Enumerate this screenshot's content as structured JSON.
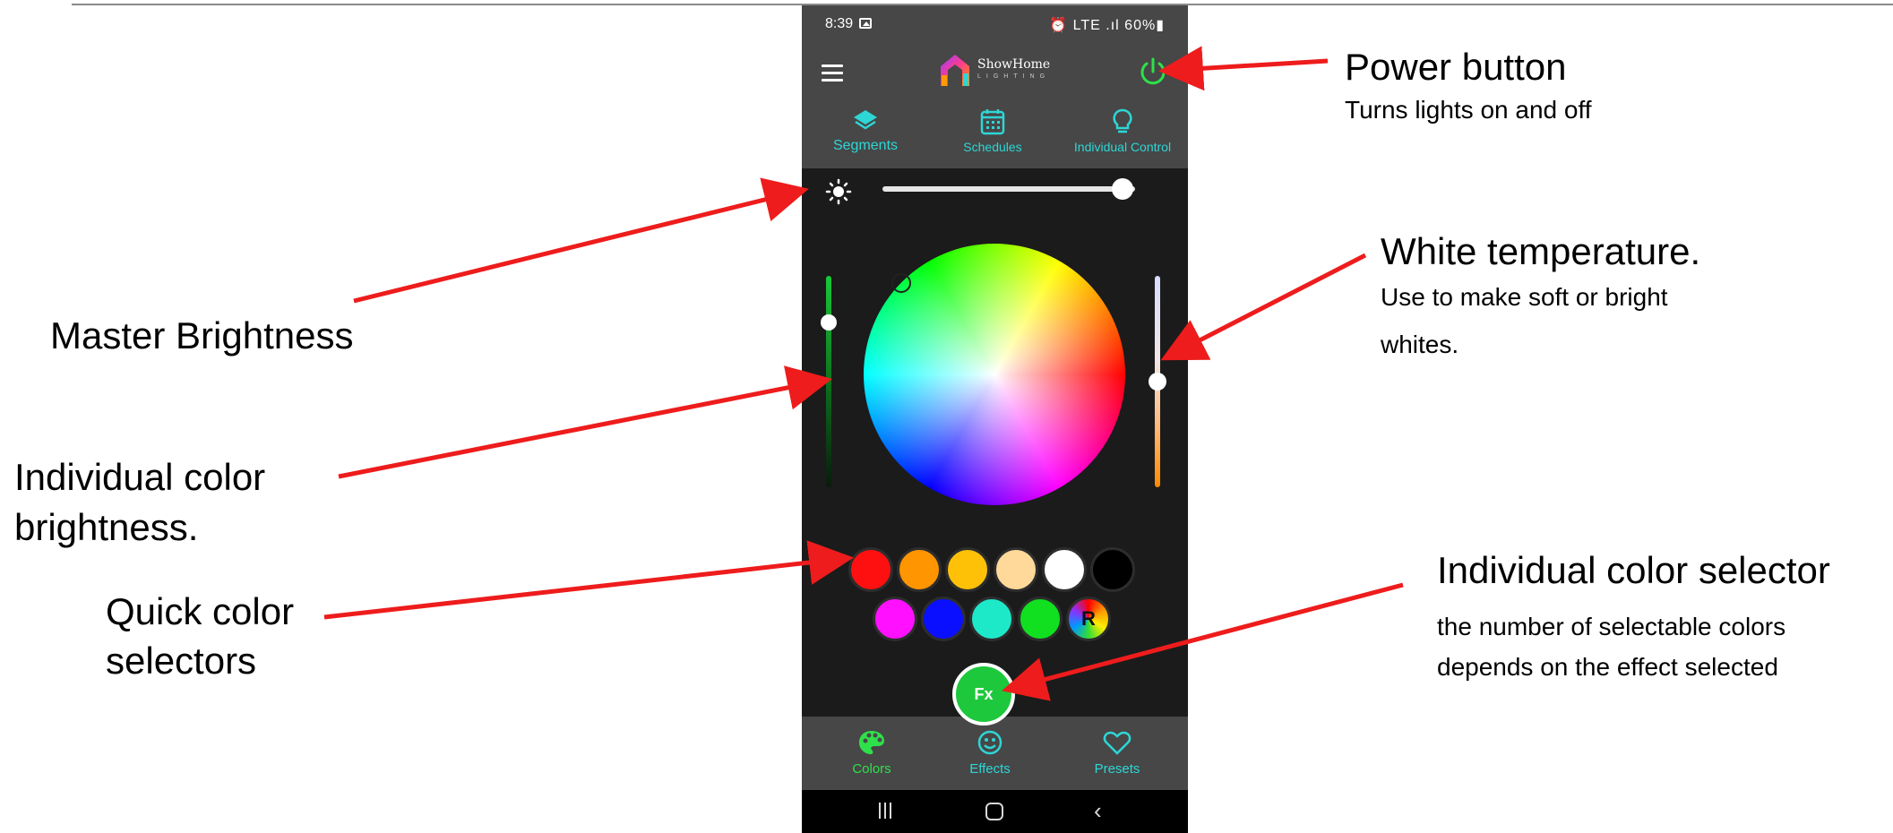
{
  "phone": {
    "status_bar": {
      "time": "8:39",
      "right_status": "⏰ LTE .ıl 60%▮"
    },
    "header": {
      "brand_name": "ShowHome",
      "brand_sub": "LIGHTING"
    },
    "nav_tabs": [
      {
        "label": "Segments",
        "icon": "layers-icon"
      },
      {
        "label": "Schedules",
        "icon": "calendar-icon"
      },
      {
        "label": "Individual Control",
        "icon": "bulb-icon"
      }
    ],
    "master_brightness": 0.95,
    "color_brightness": 0.78,
    "white_temperature": 0.5,
    "quick_colors_row1": [
      "#ff1010",
      "#ff9500",
      "#ffc107",
      "#ffd99a",
      "#ffffff",
      "#000000"
    ],
    "quick_colors_row2": [
      "#ff10ff",
      "#0a10ff",
      "#1de9c9",
      "#10e020",
      "rainbow"
    ],
    "rainbow_label": "R",
    "fx_label": "Fx",
    "bottom_tabs": [
      {
        "label": "Colors",
        "icon": "palette-icon",
        "active": true
      },
      {
        "label": "Effects",
        "icon": "smiley-icon",
        "active": false
      },
      {
        "label": "Presets",
        "icon": "heart-icon",
        "active": false
      }
    ],
    "accent_color": "#2ed6d6",
    "active_color": "#2ee04a",
    "power_color": "#2ee04a"
  },
  "annotations": {
    "power_title": "Power button",
    "power_desc": "Turns lights on and off",
    "master_brightness": "Master Brightness",
    "individual_brightness_line1": "Individual color",
    "individual_brightness_line2": "brightness.",
    "quick_color_line1": "Quick color",
    "quick_color_line2": "selectors",
    "white_temp_title": "White temperature.",
    "white_temp_desc_line1": "Use to make soft or bright",
    "white_temp_desc_line2": "whites.",
    "selector_title": "Individual color selector",
    "selector_desc_line1": " the number of selectable colors",
    "selector_desc_line2": "depends on the effect selected",
    "arrow_color": "#ee1c1c"
  }
}
